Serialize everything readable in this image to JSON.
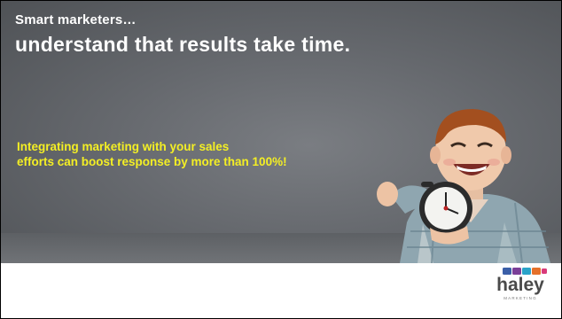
{
  "slide": {
    "kicker": "Smart marketers…",
    "headline": "understand that results take time.",
    "stat_line1": "Integrating marketing with your sales",
    "stat_line2": "efforts can boost response by more than 100%!"
  },
  "logo": {
    "wordmark": "haley",
    "subtext": "MARKETING",
    "colors": [
      "#3b5fa8",
      "#7b3f98",
      "#2aa3c9",
      "#e5712b",
      "#8cc63f",
      "#d93a7a"
    ]
  },
  "colors": {
    "background": "#66696e",
    "headline": "#ffffff",
    "stat": "#f4ef24"
  }
}
